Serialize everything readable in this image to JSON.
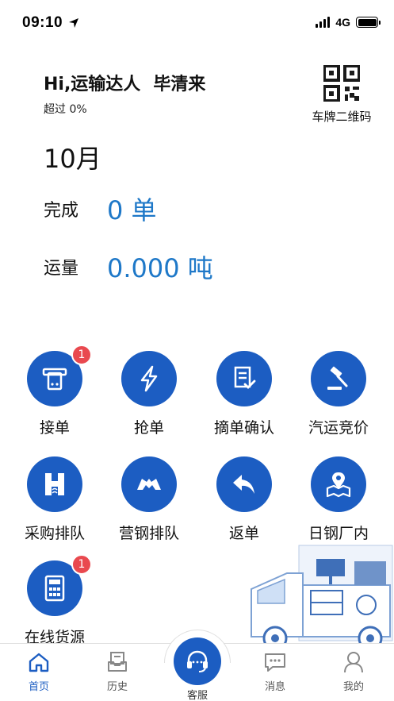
{
  "status": {
    "time": "09:10",
    "network": "4G"
  },
  "header": {
    "greeting": "Hi,运输达人",
    "user_name": "毕清来",
    "percent_text": "超过 0%",
    "qr_label": "车牌二维码"
  },
  "stats": {
    "month": "10月",
    "done_label": "完成",
    "done_value": "0 单",
    "volume_label": "运量",
    "volume_value": "0.000 吨"
  },
  "grid": [
    {
      "label": "接单",
      "icon": "receipt-printer-icon",
      "badge": "1"
    },
    {
      "label": "抢单",
      "icon": "lightning-icon"
    },
    {
      "label": "摘单确认",
      "icon": "document-check-icon"
    },
    {
      "label": "汽运竞价",
      "icon": "auction-gavel-icon"
    },
    {
      "label": "采购排队",
      "icon": "letter-h-icon"
    },
    {
      "label": "营钢排队",
      "icon": "handshake-icon"
    },
    {
      "label": "返单",
      "icon": "return-arrow-icon"
    },
    {
      "label": "日钢厂内",
      "icon": "map-pin-icon"
    },
    {
      "label": "在线货源",
      "icon": "calculator-icon",
      "badge": "1"
    }
  ],
  "tabbar": {
    "home": "首页",
    "history": "历史",
    "service": "客服",
    "messages": "消息",
    "mine": "我的"
  },
  "colors": {
    "accent": "#1c5dc2",
    "value_text": "#1e78c8",
    "badge": "#e9494f"
  }
}
